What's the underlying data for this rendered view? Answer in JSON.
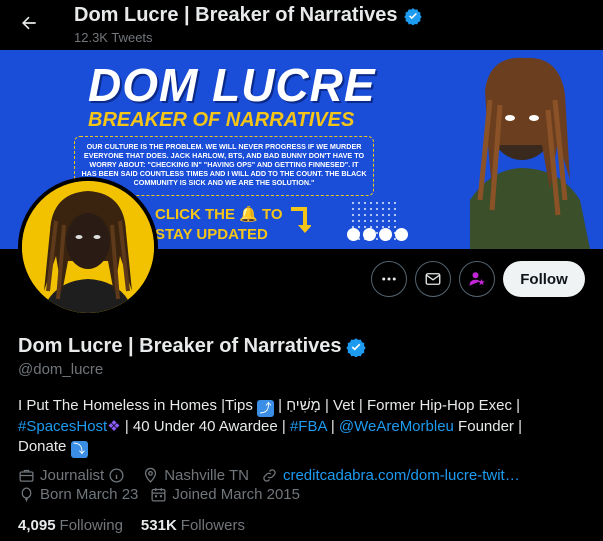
{
  "header": {
    "title": "Dom Lucre | Breaker of Narratives",
    "subtitle": "12.3K Tweets"
  },
  "banner": {
    "title": "DOM LUCRE",
    "subtitle_a": "BREAKER",
    "subtitle_b": " OF NARRATIVES",
    "quote": "OUR CULTURE IS THE PROBLEM. WE WILL NEVER PROGRESS IF WE MURDER EVERYONE THAT DOES. JACK HARLOW, BTS, AND BAD BUNNY DON'T HAVE TO WORRY ABOUT: \"CHECKING IN\" \"HAVING OPS\" AND GETTING FINNESED\". IT HAS BEEN SAID COUNTLESS TIMES AND I WILL ADD TO THE COUNT. THE BLACK COMMUNITY IS SICK AND WE ARE THE SOLUTION.\"",
    "cta_line1": "CLICK THE 🔔 TO",
    "cta_line2": "STAY UPDATED"
  },
  "actions": {
    "follow_label": "Follow"
  },
  "profile": {
    "name": "Dom Lucre | Breaker of Narratives",
    "handle": "@dom_lucre",
    "bio": {
      "line1_text": "I Put The Homeless in Homes |Tips ",
      "line1_emoji": "⤴",
      "line1_rest": " | מָשִׁיחַ | Vet | Former Hip-Hop Exec |",
      "line2_tag": "#SpacesHost",
      "line2_sparkle": "❖",
      "line2_mid": " | 40 Under 40 Awardee | ",
      "line2_tag2": "#FBA",
      "line2_sep": " | ",
      "line2_mention": "@WeAreMorbleu",
      "line2_rest": " Founder |",
      "line3_text": "Donate ",
      "line3_emoji": "⤵"
    },
    "category": "Journalist",
    "location": "Nashville TN",
    "website": "creditcadabra.com/dom-lucre-twit…",
    "born": "Born March 23",
    "joined": "Joined March 2015",
    "following_count": "4,095",
    "following_label": "Following",
    "followers_count": "531K",
    "followers_label": "Followers"
  },
  "colors": {
    "background": "#000000",
    "accent": "#1d9bf0",
    "banner": "#1a4ed8",
    "banner_yellow": "#f5c518",
    "avatar_bg": "#f2c200"
  },
  "icons": [
    "back-arrow-icon",
    "verified-badge-icon",
    "more-icon",
    "mail-icon",
    "subscribe-person-icon",
    "briefcase-icon",
    "info-icon",
    "location-pin-icon",
    "link-icon",
    "balloon-icon",
    "calendar-icon"
  ]
}
